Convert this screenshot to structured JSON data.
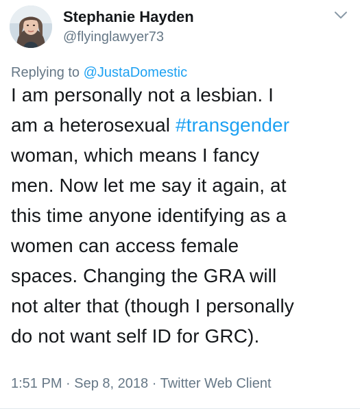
{
  "author": {
    "display_name": "Stephanie Hayden",
    "handle": "@flyinglawyer73",
    "avatar_icon": "profile-photo"
  },
  "reply": {
    "prefix": "Replying to",
    "target": "@JustaDomestic"
  },
  "tweet": {
    "lines": [
      "I am personally not a lesbian. I",
      "am a heterosexual ",
      "woman, which means I fancy",
      "men. Now let me say it again, at",
      "this time anyone identifying as a",
      "women can access female",
      "spaces. Changing the GRA will",
      "not alter that (though I personally",
      "do not want self ID for GRC)."
    ],
    "hashtag": "#transgender"
  },
  "meta": {
    "time": "1:51 PM",
    "date": "Sep 8, 2018",
    "client": "Twitter Web Client",
    "separator": "·"
  },
  "colors": {
    "link": "#1da1f2",
    "secondary_text": "#657786",
    "primary_text": "#14171a"
  },
  "icons": {
    "menu": "chevron-down-icon"
  }
}
